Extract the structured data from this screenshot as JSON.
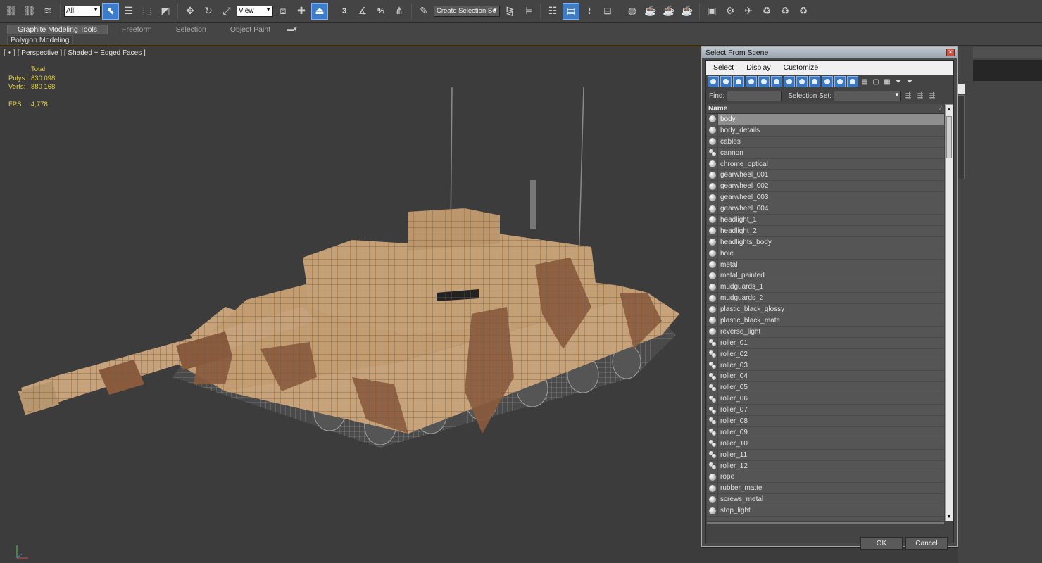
{
  "toolbar": {
    "selection_filter": "All",
    "coord_system": "View",
    "snap_3": "3",
    "percent_snap": "%",
    "selection_set_placeholder": "Create Selection Se"
  },
  "ribbon": {
    "tabs": [
      {
        "label": "Graphite Modeling Tools",
        "active": true
      },
      {
        "label": "Freeform",
        "active": false
      },
      {
        "label": "Selection",
        "active": false
      },
      {
        "label": "Object Paint",
        "active": false
      }
    ],
    "options_glyph": "▾",
    "panel_label": "Polygon Modeling"
  },
  "viewport": {
    "label": "[ + ] [ Perspective ] [ Shaded + Edged Faces ]",
    "stats_header": "Total",
    "polys_label": "Polys:",
    "polys_value": "830 098",
    "verts_label": "Verts:",
    "verts_value": "880 168",
    "fps_label": "FPS:",
    "fps_value": "4,778",
    "stats_color": "#e7d43f"
  },
  "dialog": {
    "title": "Select From Scene",
    "close_glyph": "✕",
    "menu": [
      "Select",
      "Display",
      "Customize"
    ],
    "find_label": "Find:",
    "selection_set_label": "Selection Set:",
    "column_name": "Name",
    "sort_glyph": "⁄",
    "ok_label": "OK",
    "cancel_label": "Cancel",
    "items": [
      {
        "name": "body",
        "icon": "object",
        "selected": true
      },
      {
        "name": "body_details",
        "icon": "object",
        "selected": false
      },
      {
        "name": "cables",
        "icon": "object",
        "selected": false
      },
      {
        "name": "cannon",
        "icon": "group",
        "selected": false
      },
      {
        "name": "chrome_optical",
        "icon": "object",
        "selected": false
      },
      {
        "name": "gearwheel_001",
        "icon": "object",
        "selected": false
      },
      {
        "name": "gearwheel_002",
        "icon": "object",
        "selected": false
      },
      {
        "name": "gearwheel_003",
        "icon": "object",
        "selected": false
      },
      {
        "name": "gearwheel_004",
        "icon": "object",
        "selected": false
      },
      {
        "name": "headlight_1",
        "icon": "object",
        "selected": false
      },
      {
        "name": "headlight_2",
        "icon": "object",
        "selected": false
      },
      {
        "name": "headlights_body",
        "icon": "object",
        "selected": false
      },
      {
        "name": "hole",
        "icon": "object",
        "selected": false
      },
      {
        "name": "metal",
        "icon": "object",
        "selected": false
      },
      {
        "name": "metal_painted",
        "icon": "object",
        "selected": false
      },
      {
        "name": "mudguards_1",
        "icon": "object",
        "selected": false
      },
      {
        "name": "mudguards_2",
        "icon": "object",
        "selected": false
      },
      {
        "name": "plastic_black_glossy",
        "icon": "object",
        "selected": false
      },
      {
        "name": "plastic_black_mate",
        "icon": "object",
        "selected": false
      },
      {
        "name": "reverse_light",
        "icon": "object",
        "selected": false
      },
      {
        "name": "roller_01",
        "icon": "group",
        "selected": false
      },
      {
        "name": "roller_02",
        "icon": "group",
        "selected": false
      },
      {
        "name": "roller_03",
        "icon": "group",
        "selected": false
      },
      {
        "name": "roller_04",
        "icon": "group",
        "selected": false
      },
      {
        "name": "roller_05",
        "icon": "group",
        "selected": false
      },
      {
        "name": "roller_06",
        "icon": "group",
        "selected": false
      },
      {
        "name": "roller_07",
        "icon": "group",
        "selected": false
      },
      {
        "name": "roller_08",
        "icon": "group",
        "selected": false
      },
      {
        "name": "roller_09",
        "icon": "group",
        "selected": false
      },
      {
        "name": "roller_10",
        "icon": "group",
        "selected": false
      },
      {
        "name": "roller_11",
        "icon": "group",
        "selected": false
      },
      {
        "name": "roller_12",
        "icon": "group",
        "selected": false
      },
      {
        "name": "rope",
        "icon": "object",
        "selected": false
      },
      {
        "name": "rubber_matte",
        "icon": "object",
        "selected": false
      },
      {
        "name": "screws_metal",
        "icon": "object",
        "selected": false
      },
      {
        "name": "stop_light",
        "icon": "object",
        "selected": false
      }
    ]
  },
  "axis": {
    "x": "x",
    "y": "y",
    "z": "z"
  },
  "colors": {
    "accent": "#3d7cc9",
    "viewport_bg": "#3c3c3c",
    "tank_sand": "#c8a37a",
    "tank_camo": "#8a5a3c"
  }
}
